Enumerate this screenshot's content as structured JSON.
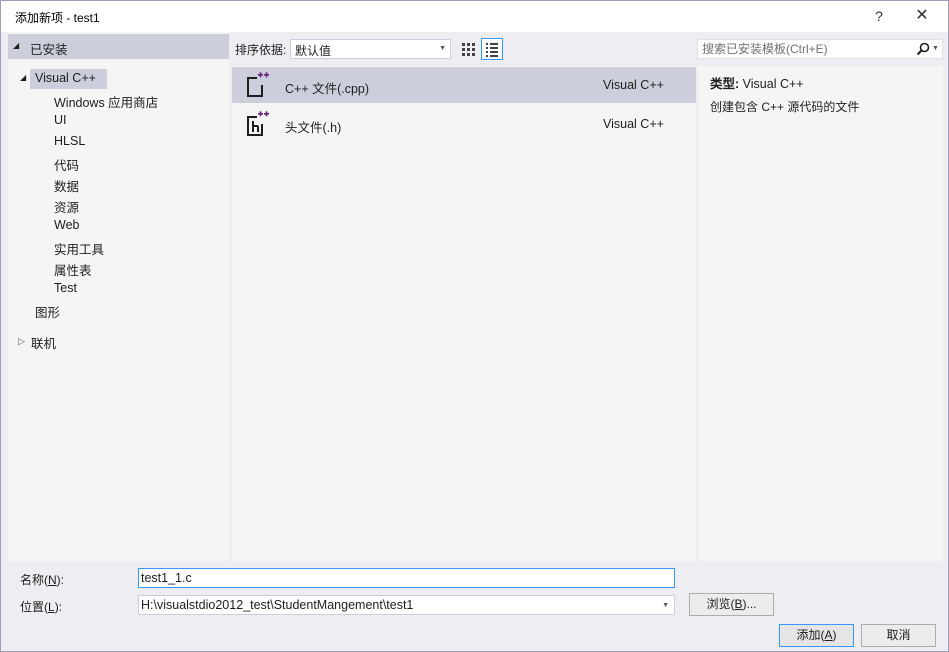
{
  "window": {
    "title": "添加新项 - test1",
    "help_label": "?",
    "close_label": "✕"
  },
  "tree": {
    "installed_label": "已安装",
    "visual_cpp_label": "Visual C++",
    "children": [
      "Windows 应用商店",
      "UI",
      "HLSL",
      "代码",
      "数据",
      "资源",
      "Web",
      "实用工具",
      "属性表",
      "Test"
    ],
    "graphics_label": "图形",
    "online_label": "联机"
  },
  "toolbar": {
    "sort_label": "排序依据:",
    "sort_value": "默认值",
    "search_placeholder": "搜索已安装模板(Ctrl+E)"
  },
  "templates": [
    {
      "name": "C++ 文件(.cpp)",
      "language": "Visual C++",
      "icon": "cpp-file-icon",
      "selected": true
    },
    {
      "name": "头文件(.h)",
      "language": "Visual C++",
      "icon": "header-file-icon",
      "selected": false
    }
  ],
  "detail": {
    "type_label": "类型:",
    "type_value": "Visual C++",
    "description": "创建包含 C++ 源代码的文件"
  },
  "form": {
    "name_label_pre": "名称(",
    "name_label_key": "N",
    "name_label_post": "):",
    "name_value": "test1_1.c",
    "location_label_pre": "位置(",
    "location_label_key": "L",
    "location_label_post": "):",
    "location_value": "H:\\visualstdio2012_test\\StudentMangement\\test1",
    "browse_pre": "浏览(",
    "browse_key": "B",
    "browse_post": ")...",
    "add_pre": "添加(",
    "add_key": "A",
    "add_post": ")",
    "cancel_label": "取消"
  },
  "colors": {
    "accent": "#3399ff",
    "selection": "#cccedb",
    "icon_purple": "#68217a"
  }
}
